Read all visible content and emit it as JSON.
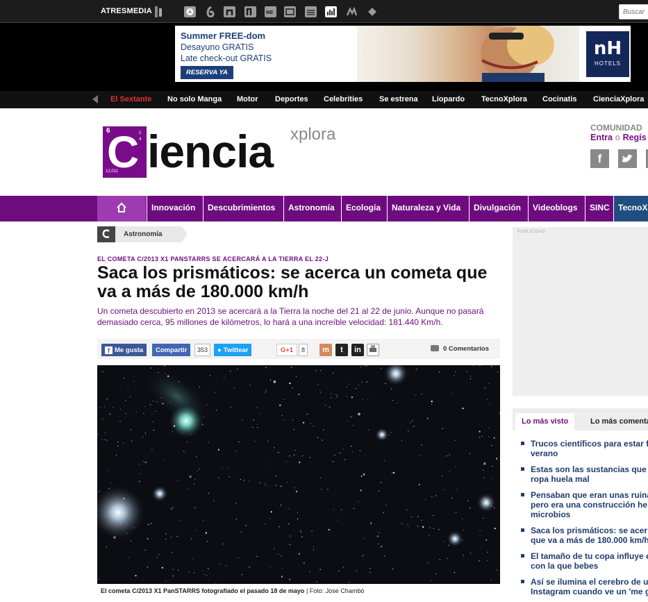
{
  "topbar": {
    "brand": "ATRESMEDIA",
    "network_icons": [
      "antena3-icon",
      "lasexta-icon",
      "neox-icon",
      "nova-icon",
      "mega-icon",
      "a3series-icon",
      "onda-cero-icon",
      "europa-fm-icon",
      "melodia-fm-icon",
      "atresplayer-icon"
    ],
    "search_placeholder": "Buscar"
  },
  "ad": {
    "line1": "Summer FREE-dom",
    "line2": "Desayuno GRATIS",
    "line3": "Late check-out GRATIS",
    "button": "RESERVA YA",
    "brand_mark": "nH",
    "brand_sub": "HOTELS"
  },
  "sites_nav": [
    "El Sextante",
    "No solo Manga",
    "Motor",
    "Deportes",
    "Celebrities",
    "Se estrena",
    "Líopardo",
    "TecnoXplora",
    "Cocinatis",
    "CienciaXplora"
  ],
  "logo": {
    "atomic_number": "6",
    "shells": "2\n4",
    "mass": "12,011",
    "letter": "C",
    "word": "iencia",
    "suffix": "xplora"
  },
  "community": {
    "title": "COMUNIDAD",
    "login": "Entra",
    "separator": "o",
    "register": "Regís"
  },
  "category_nav": [
    "Innovación",
    "Descubrimientos",
    "Astronomía",
    "Ecología",
    "Naturaleza y Vida",
    "Divulgación",
    "Videoblogs",
    "SINC",
    "TecnoX"
  ],
  "breadcrumb": "Astronomía",
  "article": {
    "kicker": "EL COMETA C/2013 X1 PANSTARRS SE ACERCARÁ A LA TIERRA EL 22-J",
    "headline": "Saca los prismáticos: se acerca un cometa que va a más de 180.000 km/h",
    "subtitle": "Un cometa descubierto en 2013 se acercará a la Tierra la noche del 21 al 22 de junio. Aunque no pasará demasiado cerca, 95 millones de kilómetros, lo hará a una increíble velocidad: 181.440 Km/h.",
    "caption": "El cometa C/2013 X1 PanSTARRS fotografiado el pasado 18 de mayo",
    "credit": "| Foto: Jose Chambó"
  },
  "share": {
    "facebook": "Me gusta",
    "share": "Compartir",
    "share_count": "353",
    "twitter": "Twittear",
    "gplus": "G+1",
    "gplus_count": "8",
    "comments": "0 Comentarios"
  },
  "sidebar": {
    "ad_label": "PUBLICIDAD",
    "tab_most_viewed": "Lo más visto",
    "tab_most_commented": "Lo más comentado",
    "most_viewed": [
      [
        "Trucos científicos para estar f",
        "verano"
      ],
      [
        "Estas son las sustancias que",
        "ropa huela mal"
      ],
      [
        "Pensaban que eran unas ruina",
        "pero era una construcción he",
        "microbios"
      ],
      [
        "Saca los prismáticos: se acer",
        "que va a más de 180.000 km/h"
      ],
      [
        "El tamaño de tu copa influye e",
        "con la que bebes"
      ],
      [
        "Así se ilumina el cerebro de u",
        "Instagram cuando ve un 'me g"
      ]
    ]
  },
  "colors": {
    "brand_purple": "#6e0c7f",
    "home_purple": "#9e3bb0",
    "tecno_blue": "#1f4e7f",
    "link_blue": "#1f3c6e",
    "facebook": "#3b5998",
    "twitter": "#1da1f2"
  }
}
